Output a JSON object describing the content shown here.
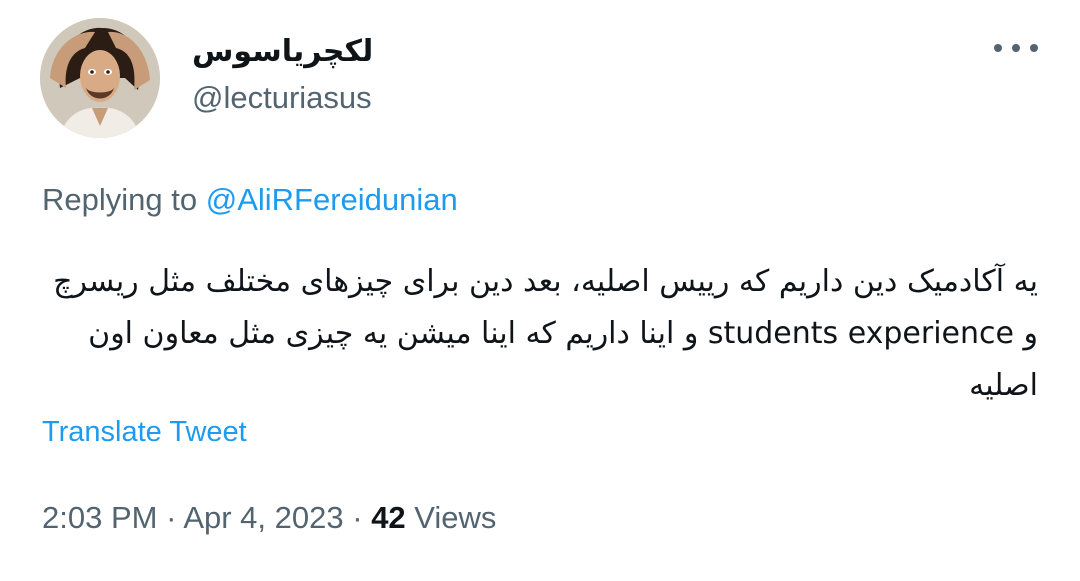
{
  "author": {
    "display_name": "لکچریاسوس",
    "handle": "@lecturiasus",
    "avatar_icon": "portrait-avatar"
  },
  "menu": {
    "icon": "more-options-icon"
  },
  "reply": {
    "prefix": "Replying to",
    "mention": "@AliRFereidunian"
  },
  "tweet": {
    "text": "یه آکادمیک دین داریم که رییس اصلیه، بعد دین برای چیزهای مختلف مثل ریسرچ و students experience و اینا داریم که اینا میشن یه چیزی مثل معاون اون اصلیه"
  },
  "translate_label": "Translate Tweet",
  "meta": {
    "time": "2:03 PM",
    "separator": "·",
    "date": "Apr 4, 2023",
    "views_count": "42",
    "views_label": "Views"
  },
  "colors": {
    "text": "#0f1419",
    "secondary": "#536471",
    "accent": "#1d9bf0",
    "background": "#ffffff"
  }
}
